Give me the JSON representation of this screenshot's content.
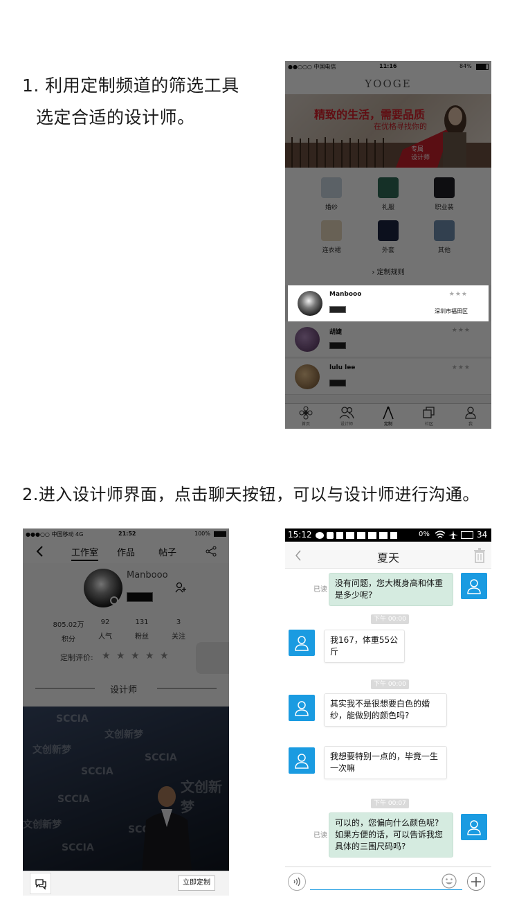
{
  "step1": {
    "line1": "1. 利用定制频道的筛选工具",
    "line2": "选定合适的设计师。"
  },
  "step2": {
    "text": "2.进入设计师界面，点击聊天按钮，可以与设计师进行沟通。"
  },
  "phone1": {
    "status": {
      "carrier": "●●○○○ 中国电信",
      "time": "11:16",
      "battery": "84%"
    },
    "brand": "YOOGE",
    "banner": {
      "headline": "精致的生活，需要品质",
      "sub": "在优格寻找你的",
      "tag1": "专属",
      "tag2": "设计师"
    },
    "categories": [
      {
        "label": "婚纱",
        "color": "#c9d7e3"
      },
      {
        "label": "礼服",
        "color": "#2f6a58"
      },
      {
        "label": "职业装",
        "color": "#1f1f26"
      },
      {
        "label": "连衣裙",
        "color": "#e6d7bc"
      },
      {
        "label": "外套",
        "color": "#1c2440"
      },
      {
        "label": "其他",
        "color": "#6f8fb0"
      }
    ],
    "rule_label": "定制规则",
    "designers": [
      {
        "name": "Manbooo",
        "stars": "★★★",
        "location": "深圳市福田区"
      },
      {
        "name": "胡婕",
        "stars": "★★★",
        "location": ""
      },
      {
        "name": "lulu lee",
        "stars": "★★★",
        "location": ""
      }
    ],
    "tabs": [
      {
        "label": "首页",
        "icon": "flower-icon"
      },
      {
        "label": "设计师",
        "icon": "people-icon"
      },
      {
        "label": "定制",
        "icon": "compass-icon"
      },
      {
        "label": "社区",
        "icon": "cards-icon"
      },
      {
        "label": "我",
        "icon": "person-icon"
      }
    ]
  },
  "phone2": {
    "status": {
      "carrier": "●●●○○ 中国移动  4G",
      "time": "21:52",
      "battery": "100%"
    },
    "tabs": [
      "工作室",
      "作品",
      "帖子"
    ],
    "profile_name": "Manbooo",
    "stats": [
      {
        "value": "805.02万",
        "label": "积分"
      },
      {
        "value": "92",
        "label": "人气"
      },
      {
        "value": "131",
        "label": "粉丝"
      },
      {
        "value": "3",
        "label": "关注"
      }
    ],
    "rating_label": "定制评价:",
    "rating_stars": "★ ★ ★ ★ ★",
    "section_title": "设计师",
    "watermarks": {
      "a": "SCCIA",
      "b": "文创新梦"
    },
    "order_button": "立即定制"
  },
  "phone3": {
    "status": {
      "time": "15:12",
      "signal": "0%",
      "battery_num": "34"
    },
    "title": "夏天",
    "messages": [
      {
        "side": "right",
        "read": "已读",
        "text": "没有问题，您大概身高和体重是多少呢?"
      },
      {
        "side": "time",
        "text": "下午 00:00"
      },
      {
        "side": "left",
        "text": "我167，体重55公斤"
      },
      {
        "side": "time",
        "text": "下午 00:00"
      },
      {
        "side": "left",
        "text": "其实我不是很想要白色的婚纱，能做别的颜色吗?"
      },
      {
        "side": "left",
        "text": "我想要特别一点的，毕竟一生一次嘛"
      },
      {
        "side": "time",
        "text": "下午 00:07"
      },
      {
        "side": "right",
        "read": "已读",
        "text": "可以的，您偏向什么颜色呢?如果方便的话，可以告诉我您具体的三围尺码吗?"
      }
    ]
  }
}
